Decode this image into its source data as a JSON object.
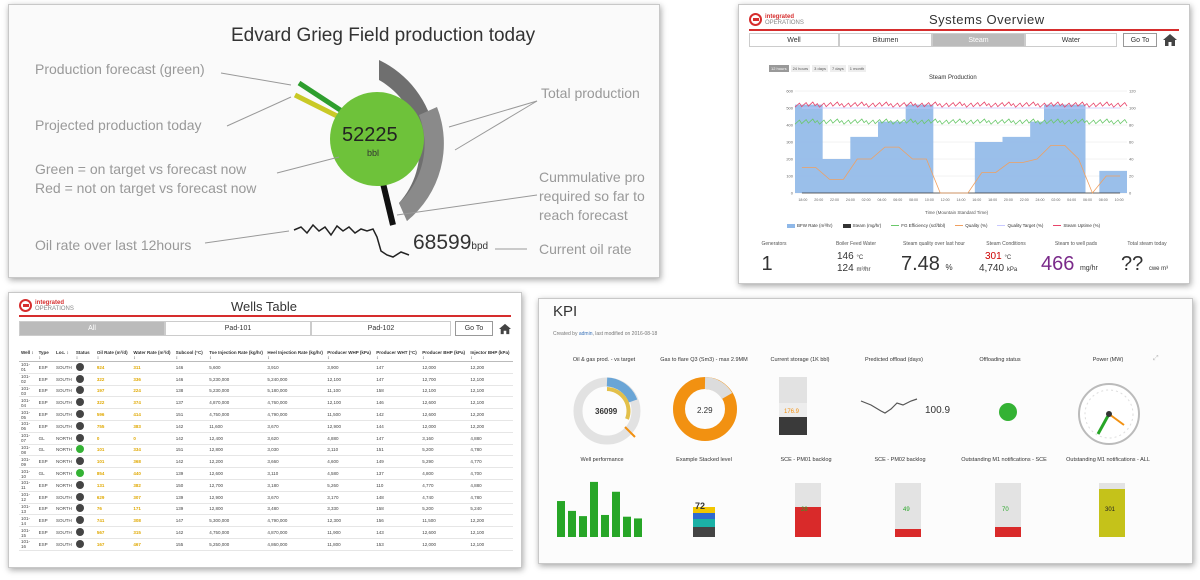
{
  "grieg": {
    "title": "Edvard Grieg Field production today",
    "labels": {
      "forecast": "Production forecast (green)",
      "projected": "Projected production today",
      "green_rule": "Green = on target vs forecast now",
      "red_rule": "Red = not on target vs forecast now",
      "oil_rate": "Oil rate over last 12hours",
      "total": "Total production",
      "cum1": "Cummulative pro",
      "cum2": "required so far to",
      "cum3": "reach forecast",
      "current": "Current oil rate"
    },
    "gauge_value": "52225",
    "gauge_unit": "bbl",
    "current_rate": "68599",
    "current_unit": "bpd",
    "colors": {
      "green": "#6ec23a",
      "ring": "#707070",
      "text": "#999999"
    }
  },
  "systems": {
    "logo_line1": "integrated",
    "logo_line2": "OPERATIONS",
    "title": "Systems Overview",
    "tabs": [
      "Well",
      "Bitumen",
      "Steam",
      "Water"
    ],
    "active_tab": "Steam",
    "goto": "Go To",
    "ranges": [
      "12 hours",
      "24 hours",
      "3 days",
      "7 days",
      "1 month"
    ],
    "chart_title": "Steam Production",
    "xaxis_title": "Time (Mountain Standard Time)",
    "legend": [
      "BFW Rate (m³/hr)",
      "Steam (mg/hr)",
      "FG Efficiency (scf/bbl)",
      "Quality (%)",
      "Quality Target (%)",
      "Steam Uptime (%)"
    ],
    "kpis": [
      {
        "label": "Generators",
        "value": "1",
        "unit": ""
      },
      {
        "label": "Boiler Feed Water",
        "value": "146",
        "unit": "°C",
        "value2": "124",
        "unit2": "m³/hr"
      },
      {
        "label": "Steam quality over last hour",
        "value": "7.48",
        "unit": "%"
      },
      {
        "label": "Steam Conditions",
        "value": "301",
        "unit": "°C",
        "value2": "4,740",
        "unit2": "kPa"
      },
      {
        "label": "Steam to well pads",
        "value": "466",
        "unit": "mg/hr"
      },
      {
        "label": "Total steam today",
        "value": "??",
        "unit": "cwe m³"
      }
    ]
  },
  "wells": {
    "logo_line1": "integrated",
    "logo_line2": "OPERATIONS",
    "title": "Wells Table",
    "tabs": [
      "All",
      "Pad-101",
      "Pad-102"
    ],
    "goto": "Go To",
    "columns": [
      "Well ↕",
      "Type ↕",
      "Loc. ↕",
      "Status ↕",
      "Oil Rate (m³/d) ↕",
      "Water Rate (m³/d) ↕",
      "Subcool (°C) ↕",
      "Toe Injection Rate (kg/hr) ↕",
      "Heel Injection Rate (kg/hr) ↕",
      "Producer WHP (kPa) ↕",
      "Producer WHT (°C) ↕",
      "Producer BHP (kPa) ↕",
      "Injector BHP (kPa) ↕"
    ],
    "rows": [
      [
        "101-01",
        "ESP",
        "SOUTH",
        "d",
        "924",
        "311",
        "146",
        "5,600",
        "3,910",
        "3,900",
        "147",
        "12,000",
        "12,200"
      ],
      [
        "101-02",
        "ESP",
        "SOUTH",
        "d",
        "322",
        "336",
        "146",
        "5,230,000",
        "5,240,000",
        "12,100",
        "147",
        "12,700",
        "12,100"
      ],
      [
        "101-03",
        "ESP",
        "SOUTH",
        "d",
        "197",
        "224",
        "138",
        "5,230,000",
        "5,180,000",
        "11,100",
        "158",
        "12,100",
        "12,100"
      ],
      [
        "101-04",
        "ESP",
        "SOUTH",
        "d",
        "322",
        "374",
        "137",
        "4,870,000",
        "4,760,000",
        "12,100",
        "146",
        "12,600",
        "12,100"
      ],
      [
        "101-05",
        "ESP",
        "SOUTH",
        "d",
        "596",
        "414",
        "151",
        "4,750,000",
        "4,790,000",
        "11,500",
        "142",
        "12,600",
        "12,200"
      ],
      [
        "101-06",
        "ESP",
        "SOUTH",
        "d",
        "755",
        "383",
        "142",
        "11,600",
        "3,670",
        "12,900",
        "144",
        "12,000",
        "12,200"
      ],
      [
        "101-07",
        "GL",
        "NORTH",
        "d",
        "0",
        "0",
        "142",
        "12,400",
        "3,620",
        "4,880",
        "147",
        "3,160",
        "4,880"
      ],
      [
        "101-08",
        "GL",
        "NORTH",
        "g",
        "101",
        "334",
        "151",
        "12,800",
        "3,030",
        "3,110",
        "151",
        "5,200",
        "4,780"
      ],
      [
        "101-09",
        "ESP",
        "NORTH",
        "d",
        "101",
        "368",
        "142",
        "12,200",
        "3,660",
        "4,600",
        "149",
        "5,290",
        "4,770"
      ],
      [
        "101-10",
        "GL",
        "NORTH",
        "g",
        "854",
        "440",
        "139",
        "12,600",
        "3,110",
        "4,580",
        "137",
        "4,800",
        "4,700"
      ],
      [
        "101-11",
        "ESP",
        "NORTH",
        "d",
        "131",
        "382",
        "150",
        "12,700",
        "3,180",
        "5,260",
        "110",
        "4,770",
        "4,880"
      ],
      [
        "101-12",
        "ESP",
        "SOUTH",
        "d",
        "629",
        "307",
        "139",
        "12,900",
        "3,670",
        "3,170",
        "148",
        "4,740",
        "4,780"
      ],
      [
        "101-13",
        "ESP",
        "NORTH",
        "d",
        "76",
        "171",
        "139",
        "12,800",
        "3,480",
        "3,330",
        "158",
        "5,200",
        "5,240"
      ],
      [
        "101-14",
        "ESP",
        "SOUTH",
        "d",
        "741",
        "308",
        "147",
        "5,300,000",
        "4,790,000",
        "12,300",
        "156",
        "11,500",
        "12,200"
      ],
      [
        "101-15",
        "ESP",
        "SOUTH",
        "d",
        "567",
        "315",
        "142",
        "4,750,000",
        "4,870,000",
        "11,900",
        "143",
        "12,600",
        "12,100"
      ],
      [
        "101-16",
        "ESP",
        "SOUTH",
        "d",
        "167",
        "467",
        "155",
        "5,250,000",
        "4,860,000",
        "11,800",
        "153",
        "12,000",
        "12,100"
      ]
    ]
  },
  "kpi": {
    "title": "KPI",
    "created_prefix": "Created by ",
    "author": "admin",
    "created_suffix": ", last modified on 2016-08-18",
    "widgets": [
      {
        "title": "Oil & gas prod. - vs target",
        "value": "36099"
      },
      {
        "title": "Gas to flare Q3 (Sm3) - max 2.9MM",
        "value": "2.29"
      },
      {
        "title": "Current storage (1K bbl)",
        "value": "176.9"
      },
      {
        "title": "Predicted offload (days)",
        "value": "100.9"
      },
      {
        "title": "Offloading status",
        "value": ""
      },
      {
        "title": "Power (MW)",
        "value": ""
      },
      {
        "title": "Well performance",
        "value": ""
      },
      {
        "title": "Example Stacked level",
        "value": "72"
      },
      {
        "title": "SCE - PM01 backlog",
        "value": "28"
      },
      {
        "title": "SCE - PM02 backlog",
        "value": "49"
      },
      {
        "title": "Outstanding M1 notifications - SCE",
        "value": "70"
      },
      {
        "title": "Outstanding M1 notifications - ALL",
        "value": "301"
      }
    ],
    "well_bars": [
      0.62,
      0.45,
      0.36,
      0.95,
      0.38,
      0.78,
      0.35,
      0.32
    ],
    "colors": {
      "green": "#27a627",
      "orange": "#f29111",
      "red": "#d92a2a",
      "olive": "#c5c21a"
    }
  },
  "chart_data": {
    "type": "line",
    "title": "Steam Production",
    "xlabel": "Time (Mountain Standard Time)",
    "x": [
      "18:00",
      "20:00",
      "22:00",
      "24:00",
      "02:00",
      "04:00",
      "06:00",
      "08:00",
      "10:00",
      "12:00",
      "14:00",
      "16:00",
      "18:00",
      "20:00",
      "22:00",
      "24:00",
      "02:00",
      "04:00",
      "06:00",
      "08:00",
      "10:00"
    ],
    "ylim_left": [
      0,
      600
    ],
    "ylim_right": [
      0,
      120
    ],
    "yticks_left": [
      0,
      100,
      200,
      300,
      400,
      500,
      600
    ],
    "yticks_right": [
      0,
      20,
      40,
      60,
      80,
      100,
      120
    ],
    "series": [
      {
        "name": "BFW Rate (m³/hr)",
        "type": "area",
        "color": "#8fb8e8",
        "values": [
          520,
          520,
          200,
          200,
          330,
          330,
          420,
          420,
          520,
          520,
          0,
          0,
          0,
          300,
          300,
          330,
          330,
          420,
          520,
          520,
          520,
          0,
          130,
          130
        ]
      },
      {
        "name": "Steam (mg/hr)",
        "type": "line",
        "color": "#333333",
        "values": [
          0,
          0,
          0,
          0,
          0,
          0,
          0,
          0,
          0,
          0,
          0,
          0,
          0,
          0,
          0,
          0,
          0,
          0,
          0,
          0,
          0,
          0,
          0,
          0
        ]
      },
      {
        "name": "FG Efficiency (scf/bbl)",
        "type": "line",
        "color": "#6ac86a",
        "values": [
          420,
          420,
          420,
          420,
          420,
          420,
          420,
          420,
          420,
          420,
          420,
          420,
          420,
          420,
          420,
          420,
          420,
          420,
          420,
          420,
          420,
          420,
          420,
          420
        ]
      },
      {
        "name": "Quality (%)",
        "type": "line",
        "color": "#f0a060",
        "values": [
          150,
          150,
          80,
          80,
          200,
          200,
          270,
          270,
          200,
          200,
          0,
          0,
          0,
          120,
          120,
          180,
          180,
          200,
          280,
          280,
          200,
          0,
          100,
          100
        ]
      },
      {
        "name": "Quality Target (%)",
        "type": "line",
        "color": "#c8c8ff",
        "values": [
          500,
          500,
          500,
          500,
          500,
          500,
          500,
          500,
          500,
          500,
          500,
          500,
          500,
          500,
          500,
          500,
          500,
          500,
          500,
          500,
          500,
          500,
          500,
          500
        ]
      },
      {
        "name": "Steam Uptime (%)",
        "type": "line",
        "color": "#e8446a",
        "values": [
          520,
          520,
          520,
          520,
          520,
          520,
          520,
          520,
          520,
          520,
          520,
          520,
          520,
          520,
          520,
          520,
          520,
          520,
          520,
          520,
          520,
          520,
          520,
          520
        ]
      }
    ]
  }
}
